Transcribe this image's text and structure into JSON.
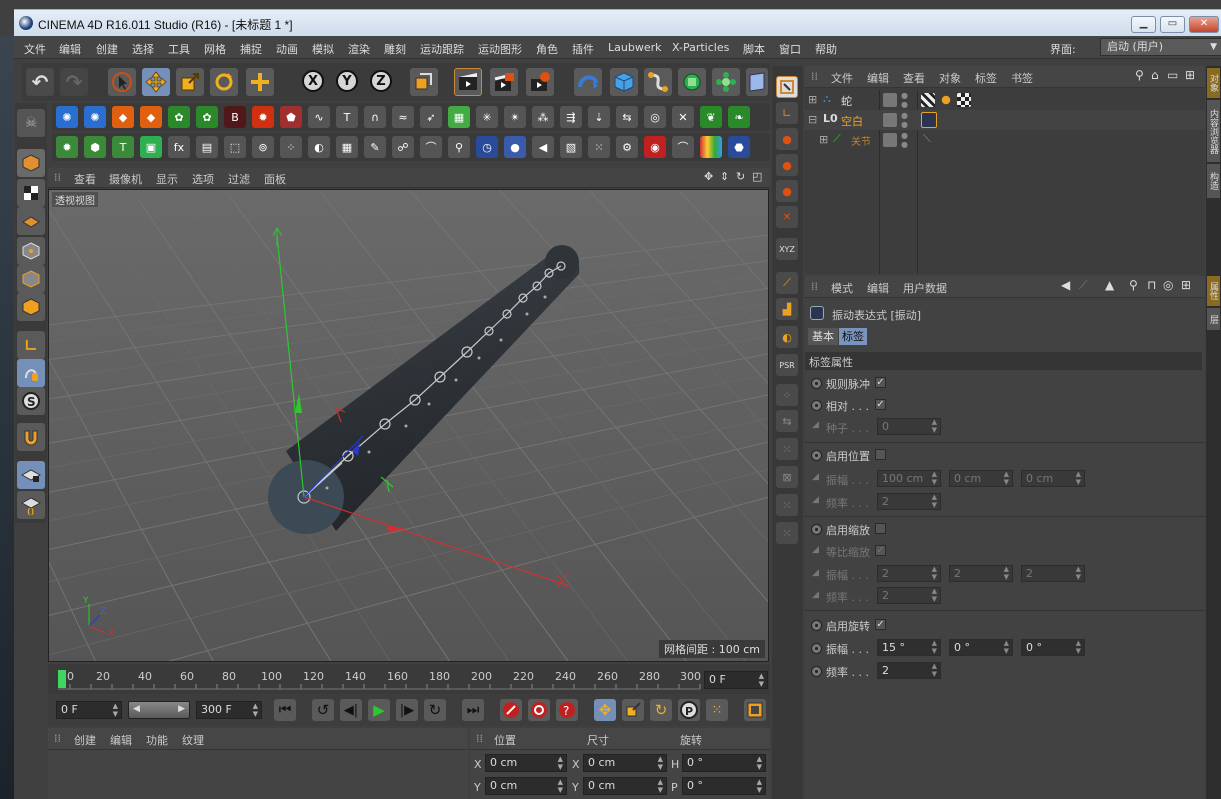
{
  "window": {
    "title": "CINEMA 4D R16.011 Studio (R16) - [未标题 1 *]",
    "minimize": "▭",
    "restore": "▭",
    "close": "✕"
  },
  "menu": {
    "items": [
      "文件",
      "编辑",
      "创建",
      "选择",
      "工具",
      "网格",
      "捕捉",
      "动画",
      "模拟",
      "渲染",
      "雕刻",
      "运动跟踪",
      "运动图形",
      "角色",
      "插件",
      "Laubwerk",
      "X-Particles",
      "脚本",
      "窗口",
      "帮助"
    ],
    "layout_label": "界面:",
    "layout_value": "启动 (用户)"
  },
  "viewport": {
    "menu": [
      "查看",
      "摄像机",
      "显示",
      "选项",
      "过滤",
      "面板"
    ],
    "view_name": "透视视图",
    "grid_spacing": "网格间距 : 100 cm",
    "axis_x": "X",
    "axis_y": "Y",
    "axis_z": "Z"
  },
  "timeline": {
    "ticks": [
      "0",
      "20",
      "40",
      "60",
      "80",
      "100",
      "120",
      "140",
      "160",
      "180",
      "200",
      "220",
      "240",
      "260",
      "280",
      "300"
    ],
    "current_frame": "0 F",
    "start_frame": "0 F",
    "end_frame": "300 F"
  },
  "material_panel": {
    "menu": [
      "创建",
      "编辑",
      "功能",
      "纹理"
    ]
  },
  "coord_panel": {
    "headers": [
      "位置",
      "尺寸",
      "旋转"
    ],
    "rows": [
      {
        "a": "X",
        "pos": "0 cm",
        "b": "X",
        "size": "0 cm",
        "c": "H",
        "rot": "0 °"
      },
      {
        "a": "Y",
        "pos": "0 cm",
        "b": "Y",
        "size": "0 cm",
        "c": "P",
        "rot": "0 °"
      }
    ]
  },
  "object_manager": {
    "menu": [
      "文件",
      "编辑",
      "查看",
      "对象",
      "标签",
      "书签"
    ],
    "objects": [
      {
        "name": "蛇",
        "color": "#dddddd"
      },
      {
        "name": "空白",
        "color": "#f0a020"
      },
      {
        "name": "关节",
        "color": "#c08030"
      }
    ]
  },
  "attribute_manager": {
    "menu": [
      "模式",
      "编辑",
      "用户数据"
    ],
    "title": "振动表达式 [振动]",
    "tabs": [
      "基本",
      "标签"
    ],
    "section": "标签属性",
    "regular_pulse": {
      "label": "规则脉冲",
      "check": "✓"
    },
    "relative": {
      "label": "相对 . . .",
      "check": "✓"
    },
    "seed": {
      "label": "种子 . . .",
      "value": "0"
    },
    "enable_position": {
      "label": "启用位置",
      "check": ""
    },
    "pos_amplitude": {
      "label": "振幅 . . .",
      "v1": "100 cm",
      "v2": "0 cm",
      "v3": "0 cm"
    },
    "pos_frequency": {
      "label": "频率 . . .",
      "value": "2"
    },
    "enable_scale": {
      "label": "启用缩放",
      "check": ""
    },
    "uniform_scale": {
      "label": "等比缩放",
      "check": "✓"
    },
    "scale_amplitude": {
      "label": "振幅 . . .",
      "v1": "2",
      "v2": "2",
      "v3": "2"
    },
    "scale_frequency": {
      "label": "频率 . . .",
      "value": "2"
    },
    "enable_rotation": {
      "label": "启用旋转",
      "check": "✓"
    },
    "rot_amplitude": {
      "label": "振幅 . . .",
      "v1": "15 °",
      "v2": "0 °",
      "v3": "0 °"
    },
    "rot_frequency": {
      "label": "频率 . . .",
      "value": "2"
    }
  },
  "side_tabs": {
    "tab1": "对象",
    "tab2": "内容浏览器",
    "tab3": "构造",
    "tab4": "属性",
    "tab5": "层"
  }
}
